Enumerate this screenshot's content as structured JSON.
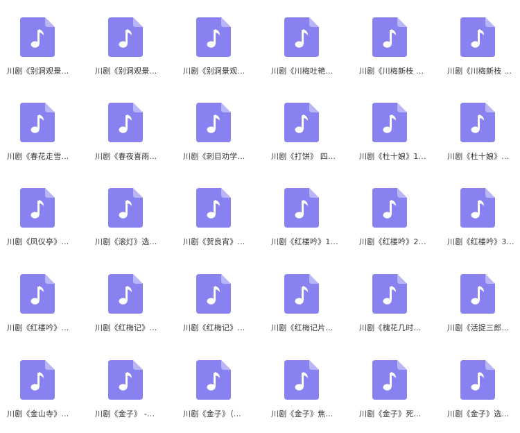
{
  "colors": {
    "icon_body": "#8882f0",
    "icon_fold": "#b9b5f7",
    "icon_glyph": "#ffffff",
    "label_text": "#333333",
    "background": "#ffffff"
  },
  "file_icon_name": "music-file-icon",
  "files": [
    {
      "name": "川剧《别洞观景..."
    },
    {
      "name": "川剧《别洞观景..."
    },
    {
      "name": "川剧《别洞景观..."
    },
    {
      "name": "川剧《川梅吐艳..."
    },
    {
      "name": "川剧《川梅新枝 ..."
    },
    {
      "name": "川剧《川梅新枝 ..."
    },
    {
      "name": "川剧《春花走雪..."
    },
    {
      "name": "川剧《春夜喜雨..."
    },
    {
      "name": "川剧《刺目劝学..."
    },
    {
      "name": "川剧《打饼》 四..."
    },
    {
      "name": "川剧《杜十娘》1..."
    },
    {
      "name": "川剧《杜十娘》..."
    },
    {
      "name": "川剧《凤仪亭》..."
    },
    {
      "name": "川剧《滚灯》选..."
    },
    {
      "name": "川剧《贺良宵》..."
    },
    {
      "name": "川剧《红楼吟》1..."
    },
    {
      "name": "川剧《红楼吟》2..."
    },
    {
      "name": "川剧《红楼吟》3..."
    },
    {
      "name": "川剧《红楼吟》..."
    },
    {
      "name": "川剧《红梅记》..."
    },
    {
      "name": "川剧《红梅记》..."
    },
    {
      "name": "川剧《红梅记片..."
    },
    {
      "name": "川剧《槐花几时..."
    },
    {
      "name": "川剧《活捉三郎..."
    },
    {
      "name": "川剧《金山寺》..."
    },
    {
      "name": "川剧《金子》 -..."
    },
    {
      "name": "川剧《金子》（..."
    },
    {
      "name": "川剧《金子》焦..."
    },
    {
      "name": "川剧《金子》死..."
    },
    {
      "name": "川剧《金子》选..."
    }
  ]
}
